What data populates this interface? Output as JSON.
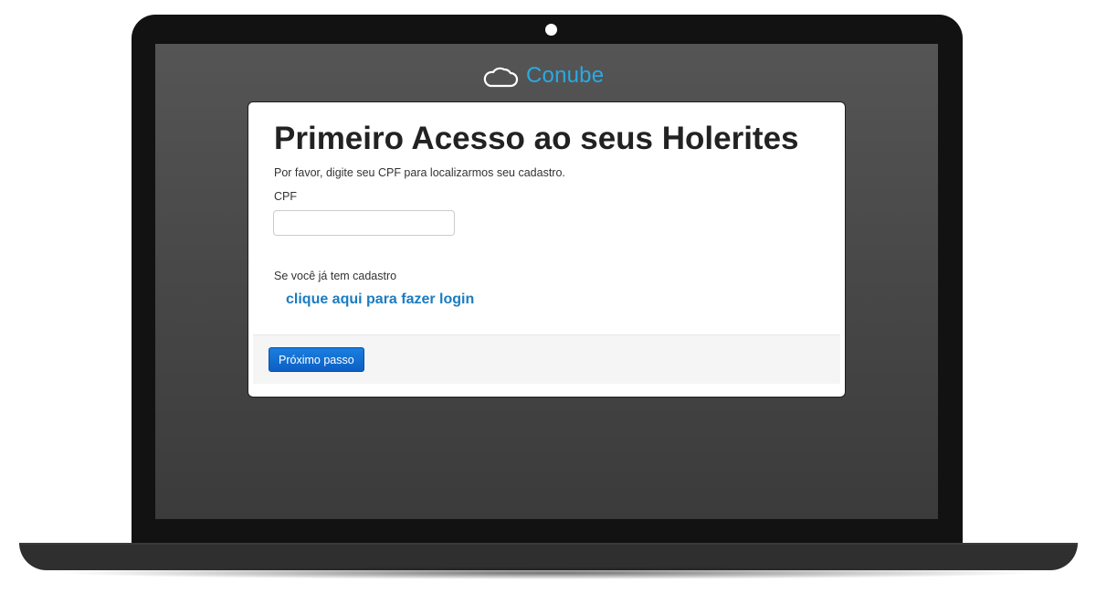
{
  "app": {
    "logo_text": "Conube",
    "logo_icon": "cloud-icon",
    "brand_color": "#29aae2"
  },
  "card": {
    "title": "Primeiro Acesso ao seus Holerites",
    "subtitle": "Por favor, digite seu CPF para localizarmos seu cadastro.",
    "cpf_label": "CPF",
    "cpf_value": "",
    "cpf_placeholder": "",
    "login_prompt": "Se você já tem cadastro",
    "login_link": "clique aqui para fazer login",
    "link_color": "#1a7cc2"
  },
  "footer": {
    "next_button_label": "Próximo passo",
    "button_color": "#0d5fc4"
  }
}
